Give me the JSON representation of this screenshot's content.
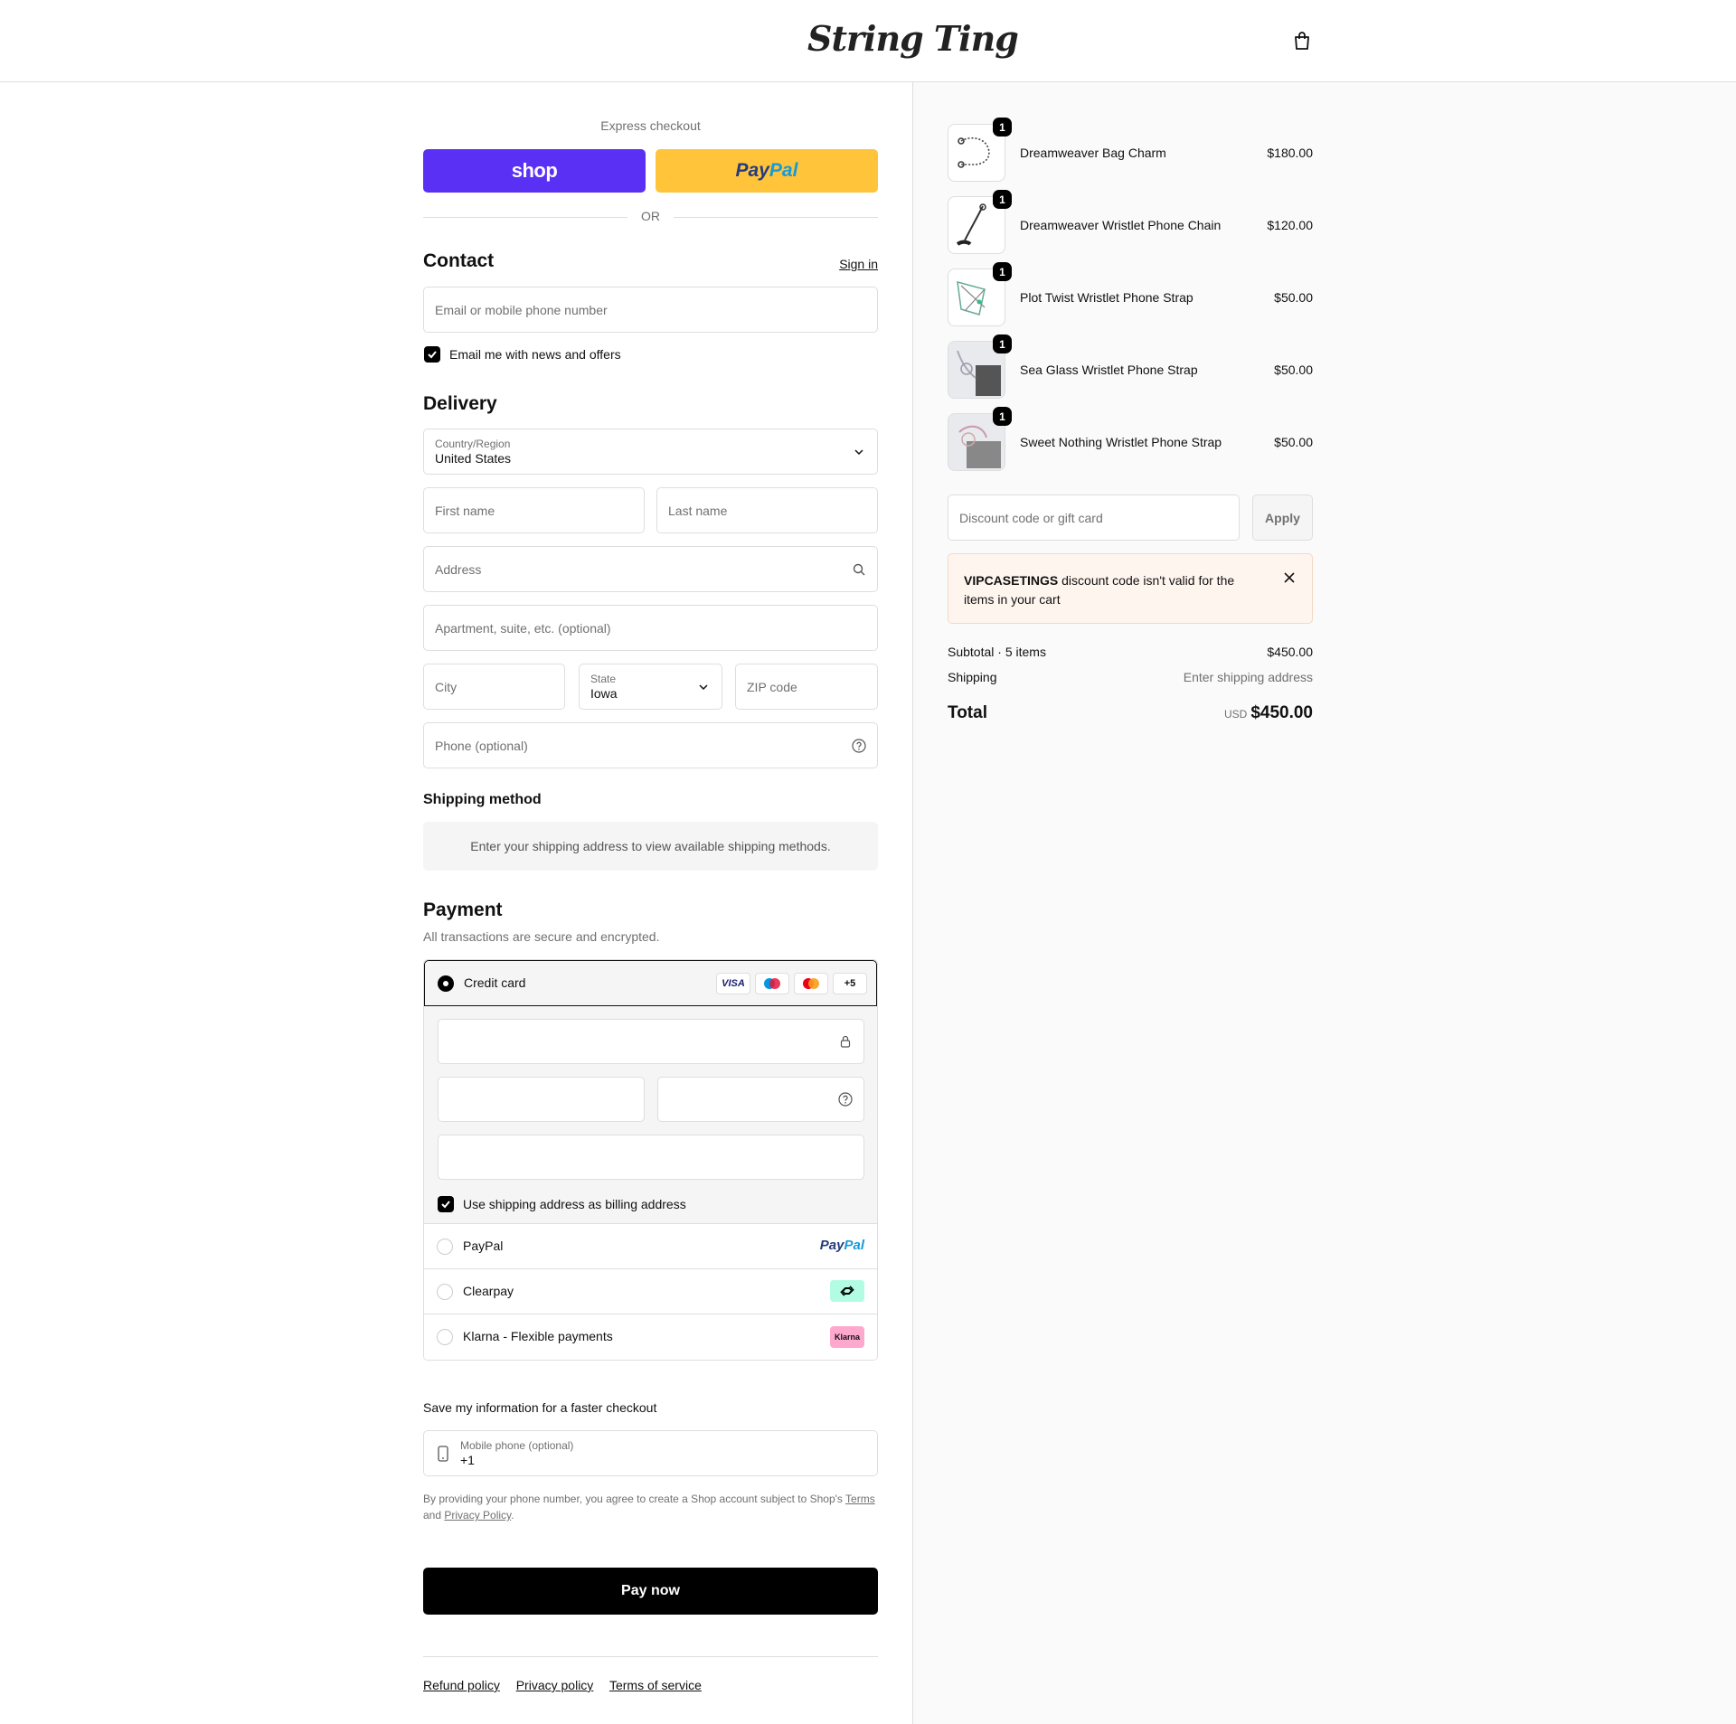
{
  "header": {
    "logo": "String Ting"
  },
  "express": {
    "label": "Express checkout",
    "shop_label": "shop",
    "paypal_pay": "Pay",
    "paypal_pal": "Pal",
    "or": "OR"
  },
  "contact": {
    "title": "Contact",
    "sign_in": "Sign in",
    "email_placeholder": "Email or mobile phone number",
    "news_label": "Email me with news and offers"
  },
  "delivery": {
    "title": "Delivery",
    "country_label": "Country/Region",
    "country_value": "United States",
    "first_name": "First name",
    "last_name": "Last name",
    "address": "Address",
    "apartment": "Apartment, suite, etc. (optional)",
    "city": "City",
    "state_label": "State",
    "state_value": "Iowa",
    "zip": "ZIP code",
    "phone": "Phone (optional)"
  },
  "shipping_method": {
    "title": "Shipping method",
    "info": "Enter your shipping address to view available shipping methods."
  },
  "payment": {
    "title": "Payment",
    "subtitle": "All transactions are secure and encrypted.",
    "credit_card": "Credit card",
    "cards": [
      "VISA",
      "+5"
    ],
    "billing_label": "Use shipping address as billing address",
    "paypal": "PayPal",
    "clearpay": "Clearpay",
    "klarna": "Klarna - Flexible payments",
    "klarna_badge": "Klarna",
    "paypal_logo_pay": "Pay",
    "paypal_logo_pal": "Pal"
  },
  "save": {
    "title": "Save my information for a faster checkout",
    "phone_label": "Mobile phone (optional)",
    "phone_value": "+1",
    "legal_1": "By providing your phone number, you agree to create a Shop account subject to Shop's ",
    "terms": "Terms",
    "legal_2": " and ",
    "privacy": "Privacy Policy",
    "legal_3": "."
  },
  "pay_now": "Pay now",
  "footer": {
    "refund": "Refund policy",
    "privacy": "Privacy policy",
    "terms": "Terms of service"
  },
  "cart": {
    "items": [
      {
        "name": "Dreamweaver Bag Charm",
        "price": "$180.00",
        "qty": "1"
      },
      {
        "name": "Dreamweaver Wristlet Phone Chain",
        "price": "$120.00",
        "qty": "1"
      },
      {
        "name": "Plot Twist Wristlet Phone Strap",
        "price": "$50.00",
        "qty": "1"
      },
      {
        "name": "Sea Glass Wristlet Phone Strap",
        "price": "$50.00",
        "qty": "1"
      },
      {
        "name": "Sweet Nothing Wristlet Phone Strap",
        "price": "$50.00",
        "qty": "1"
      }
    ],
    "discount_placeholder": "Discount code or gift card",
    "apply": "Apply",
    "alert_code": "VIPCASETINGS",
    "alert_msg": " discount code isn't valid for the items in your cart",
    "subtotal_label": "Subtotal · 5 items",
    "subtotal_value": "$450.00",
    "shipping_label": "Shipping",
    "shipping_value": "Enter shipping address",
    "total_label": "Total",
    "currency": "USD",
    "total_value": "$450.00"
  },
  "colors": {
    "shop": "#5a31f4",
    "paypal": "#ffc439",
    "alert_bg": "#fff5ef"
  }
}
